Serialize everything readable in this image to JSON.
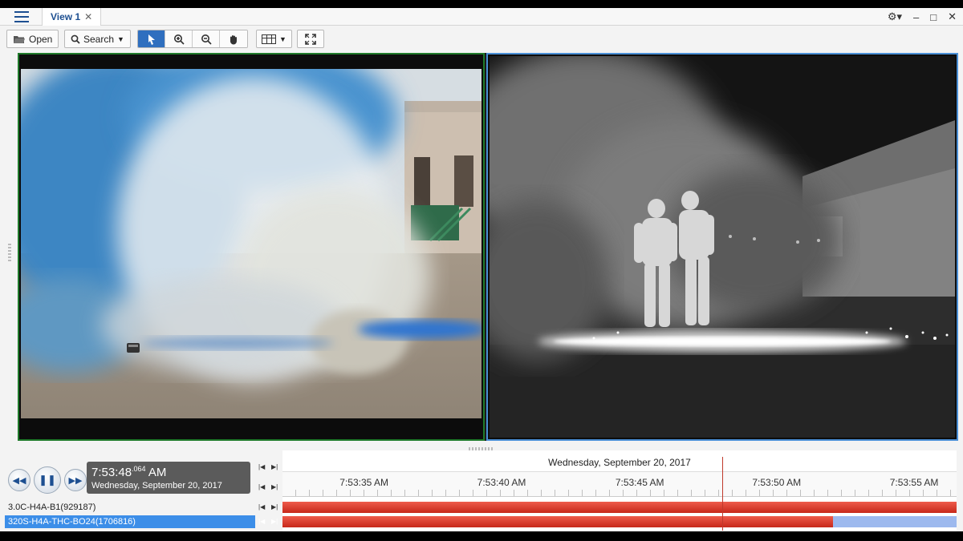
{
  "titlebar": {
    "tab_label": "View 1",
    "tab_close": "✕",
    "settings_glyph": "⚙▾",
    "minimize_glyph": "–",
    "maximize_glyph": "□",
    "close_glyph": "✕"
  },
  "toolbar": {
    "open_label": "Open",
    "search_label": "Search",
    "tools": [
      "pointer-icon",
      "zoom-in-icon",
      "zoom-out-icon",
      "pan-hand-icon"
    ],
    "layout_icon": "layout-grid-icon",
    "fullscreen_icon": "fullscreen-icon"
  },
  "playback": {
    "time_main": "7:53:48",
    "time_ms": ".064",
    "time_ampm": "AM",
    "date": "Wednesday, September 20, 2017"
  },
  "timeline": {
    "date": "Wednesday, September 20, 2017",
    "ticks": [
      {
        "label": "7:53:35 AM",
        "frac": 0.121
      },
      {
        "label": "7:53:40 AM",
        "frac": 0.325
      },
      {
        "label": "7:53:45 AM",
        "frac": 0.53
      },
      {
        "label": "7:53:50 AM",
        "frac": 0.733
      },
      {
        "label": "7:53:55 AM",
        "frac": 0.937
      }
    ],
    "cursor_frac": 0.652,
    "tracks": [
      {
        "label": "3.0C-H4A-B1(929187)",
        "recorded_frac": 1.0
      },
      {
        "label": "320S-H4A-THC-BO24(1706816)",
        "recorded_frac": 0.817
      }
    ]
  },
  "colors": {
    "accent": "#2f6fbf",
    "selected_track": "#3c8ee8",
    "recording": "#d9382a",
    "left_pane_border": "#1f7a2a",
    "right_pane_border": "#4a8fd6"
  }
}
